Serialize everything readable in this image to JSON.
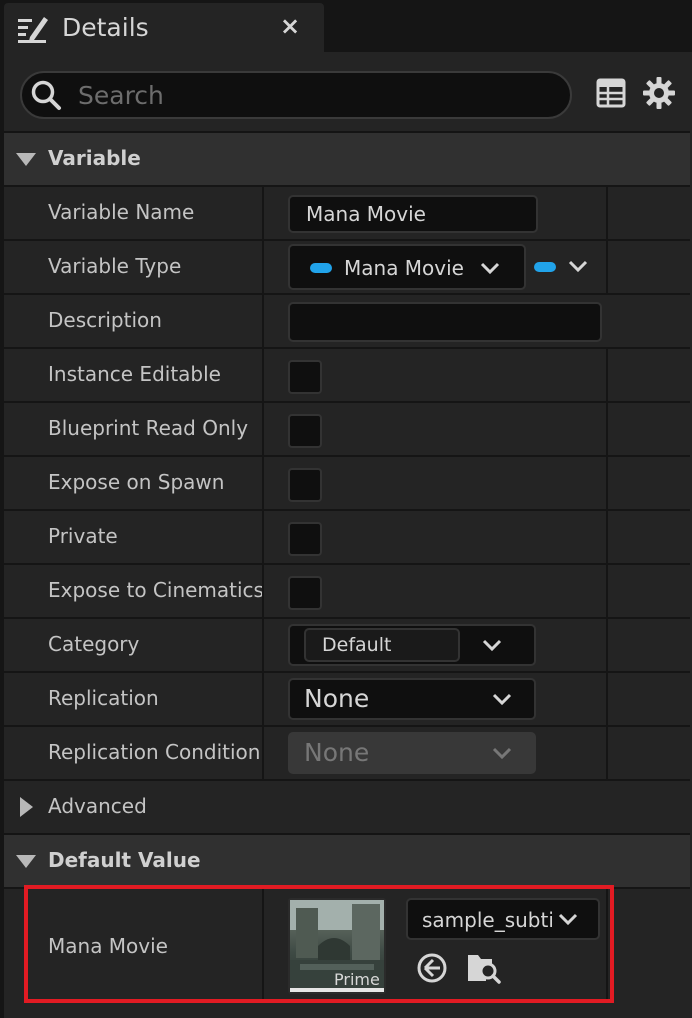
{
  "tab": {
    "title": "Details",
    "close": "×",
    "icon": "details-pencil-icon"
  },
  "search": {
    "placeholder": "Search",
    "value": ""
  },
  "toolbar": {
    "grid_icon": "property-matrix-icon",
    "settings_icon": "gear-icon"
  },
  "sections": {
    "variable": "Variable",
    "advanced": "Advanced",
    "default_value": "Default Value"
  },
  "properties": {
    "variable_name": {
      "label": "Variable Name",
      "value": "Mana Movie"
    },
    "variable_type": {
      "label": "Variable Type",
      "value": "Mana Movie",
      "pin_color": "#21a3ea"
    },
    "description": {
      "label": "Description",
      "value": ""
    },
    "instance_editable": {
      "label": "Instance Editable",
      "checked": false
    },
    "blueprint_read_only": {
      "label": "Blueprint Read Only",
      "checked": false
    },
    "expose_on_spawn": {
      "label": "Expose on Spawn",
      "checked": false
    },
    "private": {
      "label": "Private",
      "checked": false
    },
    "expose_to_cinematics": {
      "label": "Expose to Cinematics",
      "checked": false
    },
    "category": {
      "label": "Category",
      "value": "Default"
    },
    "replication": {
      "label": "Replication",
      "value": "None"
    },
    "replication_condition": {
      "label": "Replication Condition",
      "value": "None",
      "disabled": true
    }
  },
  "default_value": {
    "label": "Mana Movie",
    "asset_name": "sample_subti",
    "thumbnail_caption": "Prime",
    "use_selected_icon": "use-selected-arrow-icon",
    "browse_icon": "browse-folder-icon",
    "highlight_color": "#e21b23"
  }
}
